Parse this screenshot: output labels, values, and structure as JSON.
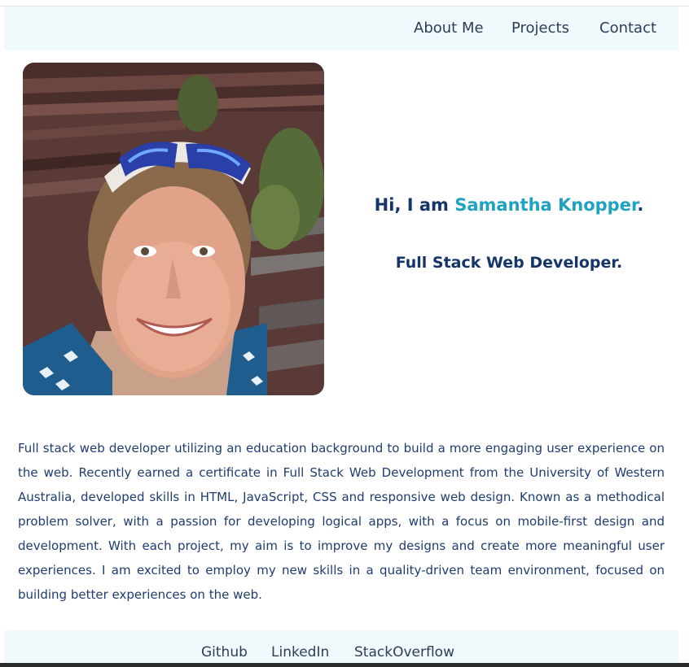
{
  "nav": {
    "about": "About Me",
    "projects": "Projects",
    "contact": "Contact"
  },
  "hero": {
    "greeting_prefix": "Hi, I am ",
    "name": "Samantha Knopper",
    "greeting_suffix": ".",
    "role": "Full Stack Web Developer."
  },
  "bio": {
    "text": "Full stack web developer utilizing an education background to build a more engaging user experience on the web. Recently earned a certificate in Full Stack Web Development from the University of Western Australia, developed skills in HTML, JavaScript, CSS and responsive web design. Known as a methodical problem solver, with a passion for developing logical apps, with a focus on mobile-first design and development. With each project, my aim is to improve my designs and create more meaningful user experiences. I am excited to employ my new skills in a quality-driven team environment, focused on building better experiences on the web."
  },
  "footer": {
    "github": "Github",
    "linkedin": "LinkedIn",
    "stackoverflow": "StackOverflow"
  },
  "colors": {
    "navy": "#153468",
    "accent": "#1fa3bf",
    "nav_bg": "#f0f9fc"
  }
}
